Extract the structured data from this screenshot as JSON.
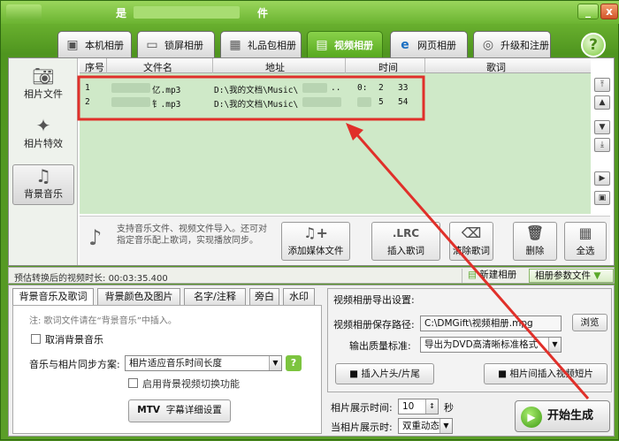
{
  "window": {
    "title_left": "是",
    "title_right": "件",
    "min": "_",
    "close": "x"
  },
  "tabs": [
    {
      "label": "本机相册",
      "icon": "photo-icon"
    },
    {
      "label": "锁屏相册",
      "icon": "monitor-icon"
    },
    {
      "label": "礼品包相册",
      "icon": "gift-icon"
    },
    {
      "label": "视频相册",
      "icon": "film-icon"
    },
    {
      "label": "网页相册",
      "icon": "ie-icon"
    },
    {
      "label": "升级和注册",
      "icon": "globe-icon"
    }
  ],
  "help": "?",
  "sidebar": {
    "items": [
      {
        "label": "相片文件",
        "icon": "camera-icon"
      },
      {
        "label": "相片特效",
        "icon": "effects-icon"
      },
      {
        "label": "背景音乐",
        "icon": "music-icon"
      }
    ]
  },
  "table": {
    "headers": [
      "序号",
      "文件名",
      "地址",
      "时间",
      "歌词"
    ],
    "rows": [
      {
        "no": "1",
        "name": "亿.mp3",
        "path": "D:\\我的文档\\Music\\",
        "dots": "..",
        "time_a": "0:",
        "time_b": "2",
        "time_c": "33"
      },
      {
        "no": "2",
        "name": "钅.mp3",
        "path": "D:\\我的文档\\Music\\",
        "dots": "..",
        "time_a": "",
        "time_b": "5",
        "time_c": "54"
      }
    ]
  },
  "toolbar": {
    "note": "支持音乐文件、视频文件导入。还可对指定音乐配上歌词，实现播放同步。",
    "buttons": [
      {
        "label": "添加媒体文件",
        "icon": "add-music-icon"
      },
      {
        "label": "插入歌词",
        "icon_text": ".LRC"
      },
      {
        "label": "清除歌词",
        "icon": "eraser-icon"
      },
      {
        "label": "删除",
        "icon": "trash-icon"
      },
      {
        "label": "全选",
        "icon": "select-all-icon"
      }
    ]
  },
  "strip": {
    "estimate_label": "预估转换后的视频时长:",
    "estimate_value": "00:03:35.400",
    "new_album": "新建相册",
    "album_params": "相册参数文件"
  },
  "bottom_tabs": [
    "背景音乐及歌词",
    "背景颜色及图片",
    "名字/注释",
    "旁白",
    "水印"
  ],
  "music": {
    "note": "注: 歌词文件请在“背景音乐”中插入。",
    "cancel_bg": "取消背景音乐",
    "sync_label": "音乐与相片同步方案:",
    "sync_value": "相片适应音乐时间长度",
    "bg_video_switch": "启用背景视频切换功能",
    "mtv_icon_text": "MTV",
    "mtv_label": "字幕详细设置"
  },
  "export": {
    "header": "视频相册导出设置:",
    "path_label": "视频相册保存路径:",
    "path_value": "C:\\DMGift\\视频相册.mpg",
    "browse": "浏览",
    "quality_label": "输出质量标准:",
    "quality_value": "导出为DVD高清晰标准格式",
    "insert_clip": "插入片头/片尾",
    "insert_short": "相片间插入视频短片"
  },
  "timing": {
    "show_time_label": "相片展示时间:",
    "show_time_value": "10",
    "unit": "秒",
    "show_mode_label": "当相片展示时:",
    "show_mode_value": "双重动态"
  },
  "start": "开始生成",
  "colors": {
    "accent": "#e0302a",
    "green": "#5aa82a"
  }
}
